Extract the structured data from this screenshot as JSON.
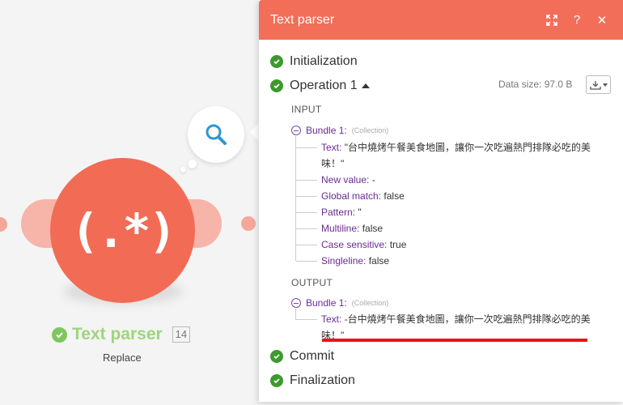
{
  "module": {
    "name": "Text parser",
    "id": "14",
    "action": "Replace",
    "glyph": "(.*)"
  },
  "panel": {
    "title": "Text parser",
    "colors": {
      "header": "#f26e58",
      "success": "#3d9a2c",
      "key": "#6a2b94",
      "highlight": "#e8141c"
    },
    "steps": {
      "initialization": "Initialization",
      "operation": "Operation 1",
      "commit": "Commit",
      "finalization": "Finalization"
    },
    "data_size": "Data size: 97.0 B",
    "input": {
      "label": "INPUT",
      "bundle_name": "Bundle 1:",
      "bundle_type": "(Collection)",
      "fields": [
        {
          "key": "Text:",
          "value": "\"台中燒烤午餐美食地圖，讓你一次吃遍熱門排隊必吃的美味！\""
        },
        {
          "key": "New value:",
          "value": "-"
        },
        {
          "key": "Global match:",
          "value": "false"
        },
        {
          "key": "Pattern:",
          "value": "\""
        },
        {
          "key": "Multiline:",
          "value": "false"
        },
        {
          "key": "Case sensitive:",
          "value": "true"
        },
        {
          "key": "Singleline:",
          "value": "false"
        }
      ]
    },
    "output": {
      "label": "OUTPUT",
      "bundle_name": "Bundle 1:",
      "bundle_type": "(Collection)",
      "fields": [
        {
          "key": "Text:",
          "value": "-台中燒烤午餐美食地圖，讓你一次吃遍熱門排隊必吃的美味！\""
        }
      ]
    }
  }
}
